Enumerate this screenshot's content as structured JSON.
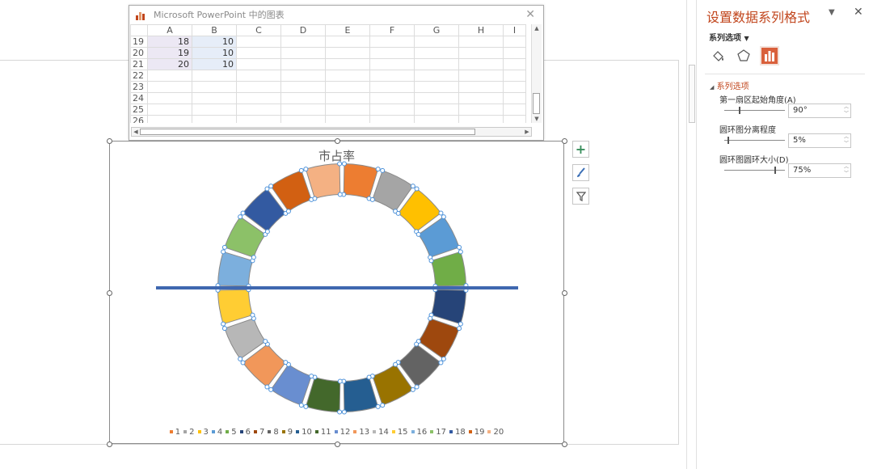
{
  "spreadsheet": {
    "title": "Microsoft PowerPoint 中的图表",
    "columns": [
      "A",
      "B",
      "C",
      "D",
      "E",
      "F",
      "G",
      "H",
      "I"
    ],
    "rows": [
      {
        "row": "19",
        "a": "18",
        "b": "10"
      },
      {
        "row": "20",
        "a": "19",
        "b": "10"
      },
      {
        "row": "21",
        "a": "20",
        "b": "10"
      },
      {
        "row": "22",
        "a": "",
        "b": ""
      },
      {
        "row": "23",
        "a": "",
        "b": ""
      },
      {
        "row": "24",
        "a": "",
        "b": ""
      },
      {
        "row": "25",
        "a": "",
        "b": ""
      },
      {
        "row": "26",
        "a": "",
        "b": ""
      }
    ]
  },
  "chart": {
    "title": "市占率",
    "legend": [
      "1",
      "2",
      "3",
      "4",
      "5",
      "6",
      "7",
      "8",
      "9",
      "10",
      "11",
      "12",
      "13",
      "14",
      "15",
      "16",
      "17",
      "18",
      "19",
      "20"
    ]
  },
  "chart_data": {
    "type": "pie",
    "title": "市占率",
    "categories": [
      "1",
      "2",
      "3",
      "4",
      "5",
      "6",
      "7",
      "8",
      "9",
      "10",
      "11",
      "12",
      "13",
      "14",
      "15",
      "16",
      "17",
      "18",
      "19",
      "20"
    ],
    "values": [
      10,
      10,
      10,
      10,
      10,
      10,
      10,
      10,
      10,
      10,
      10,
      10,
      10,
      10,
      10,
      10,
      10,
      10,
      10,
      10
    ],
    "colors": [
      "#ED7D31",
      "#A5A5A5",
      "#FFC000",
      "#5B9BD5",
      "#70AD47",
      "#264478",
      "#9E480E",
      "#636363",
      "#997300",
      "#255E91",
      "#43682B",
      "#698ED0",
      "#F1975A",
      "#B7B7B7",
      "#FFCD33",
      "#7CAFDD",
      "#8CC168",
      "#335AA1",
      "#D26012",
      "#F4B183"
    ],
    "first_slice_angle": 90,
    "explosion_percent": 5,
    "hole_size_percent": 75,
    "legend_position": "bottom"
  },
  "side_buttons": {
    "add": "chart-elements",
    "style": "chart-styles",
    "filter": "chart-filters"
  },
  "format_pane": {
    "title": "设置数据系列格式",
    "subtitle": "系列选项",
    "section": "系列选项",
    "options": [
      {
        "label": "第一扇区起始角度(A)",
        "value": "90°",
        "level": 0.25
      },
      {
        "label": "圆环图分离程度",
        "value": "5%",
        "level": 0.05
      },
      {
        "label": "圆环图圆环大小(D)",
        "value": "75%",
        "level": 0.85
      }
    ]
  }
}
